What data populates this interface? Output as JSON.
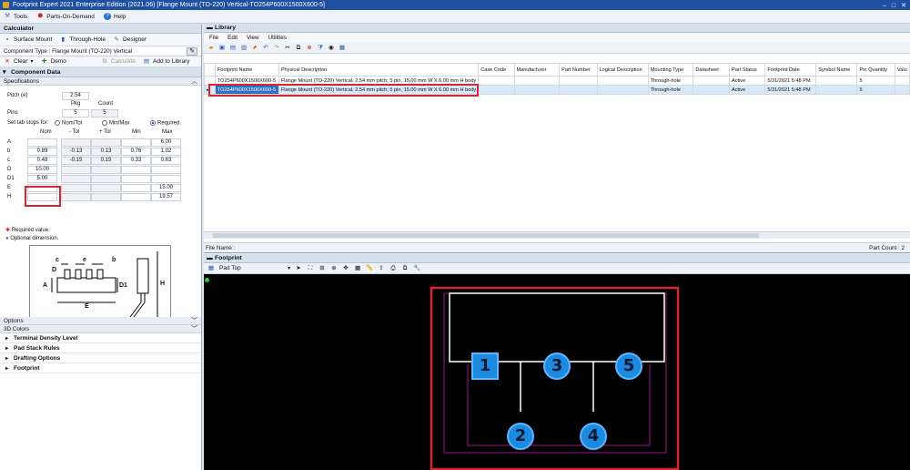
{
  "window": {
    "title": "Footprint Expert 2021 Enterprise Edition (2021.06) [Flange Mount (TO-220) Vertical-TO254P600X1500X600-5]",
    "controls": [
      "–",
      "□",
      "✕"
    ]
  },
  "top_menu": [
    "Tools",
    "Parts-On-Demand",
    "Help"
  ],
  "calculator": {
    "header": "Calculator",
    "modes": [
      "Surface Mount",
      "Through-Hole",
      "Designer"
    ],
    "component_type": "Component Type : Flange Mount (TO-220) Vertical",
    "toolbar": {
      "clear": "Clear",
      "demo": "Demo",
      "calculate": "Calculate",
      "add": "Add to Library"
    },
    "component_data": "Component Data",
    "specifications": "Specifications",
    "pitch_label": "Pitch (e)",
    "pitch_value": "2.54",
    "pkg_label": "Pkg",
    "count_label": "Count",
    "pins_label": "Pins",
    "pins_pkg": "5",
    "pins_count": "5",
    "tab_stops_label": "Set tab stops for:",
    "tab_options": [
      "Nom/Tol",
      "Min/Max",
      "Required"
    ],
    "columns": [
      "Nom",
      "- Tol",
      "+ Tol",
      "Min",
      "Max"
    ],
    "rows": [
      {
        "label": "A",
        "nom": "",
        "ntol": "",
        "ptol": "",
        "min": "",
        "max": "6.00"
      },
      {
        "label": "b",
        "nom": "0.89",
        "ntol": "-0.13",
        "ptol": "0.13",
        "min": "0.76",
        "max": "1.02"
      },
      {
        "label": "c",
        "nom": "0.48",
        "ntol": "-0.15",
        "ptol": "0.15",
        "min": "0.33",
        "max": "0.63"
      },
      {
        "label": "D",
        "nom": "10.00",
        "ntol": "",
        "ptol": "",
        "min": "",
        "max": ""
      },
      {
        "label": "D1",
        "nom": "5.00",
        "ntol": "",
        "ptol": "",
        "min": "",
        "max": ""
      },
      {
        "label": "E",
        "nom": "",
        "ntol": "",
        "ptol": "",
        "min": "",
        "max": "15.00"
      },
      {
        "label": "H",
        "nom": "",
        "ntol": "",
        "ptol": "",
        "min": "",
        "max": "19.57"
      }
    ],
    "note_required": "Required value.",
    "note_optional": "Optional dimension.",
    "diagram_labels": {
      "c": "c",
      "e": "e",
      "b": "b",
      "A": "A",
      "D": "D",
      "D1": "D1",
      "E": "E",
      "H": "H"
    },
    "options": "Options",
    "colors3d": "3D Colors",
    "tree": [
      "Terminal Density Level",
      "Pad Stack Rules",
      "Drafting Options",
      "Footprint"
    ]
  },
  "library": {
    "header": "Library",
    "menu": [
      "File",
      "Edit",
      "View",
      "Utilities"
    ],
    "columns": [
      "Footprint Name",
      "Physical Description",
      "Case Code",
      "Manufacturer",
      "Part Number",
      "Logical Description",
      "Mounting Type",
      "Datasheet",
      "Part Status",
      "Footprint Date",
      "Symbol Name",
      "Pin Quantity",
      "Valu"
    ],
    "rows": [
      [
        "TO254P600X1500X600-5",
        "Flange Mount (TO-220) Vertical, 2.54 mm pitch; 5 pin, 15.00 mm W X 6.00 mm H body",
        "",
        "",
        "",
        "",
        "Through-hole",
        "",
        "Active",
        "5/31/2021 5:48 PM",
        "",
        "5",
        ""
      ],
      [
        "TO254P600X1500X600-5",
        "Flange Mount (TO-220) Vertical, 2.54 mm pitch; 5 pin, 15.00 mm W X 6.00 mm H body",
        "",
        "",
        "",
        "",
        "Through-hole",
        "",
        "Active",
        "5/31/2021 5:48 PM",
        "",
        "5",
        ""
      ]
    ],
    "file_name_label": "File Name :",
    "part_count": "Part Count : 2"
  },
  "footprint": {
    "header": "Footprint",
    "layer": "Pad Top",
    "pads": [
      "1",
      "2",
      "3",
      "4",
      "5"
    ]
  },
  "colors": {
    "accent_red": "#d8262e",
    "pad_blue": "#1b8ae0",
    "title_blue": "#1f4fa0"
  }
}
